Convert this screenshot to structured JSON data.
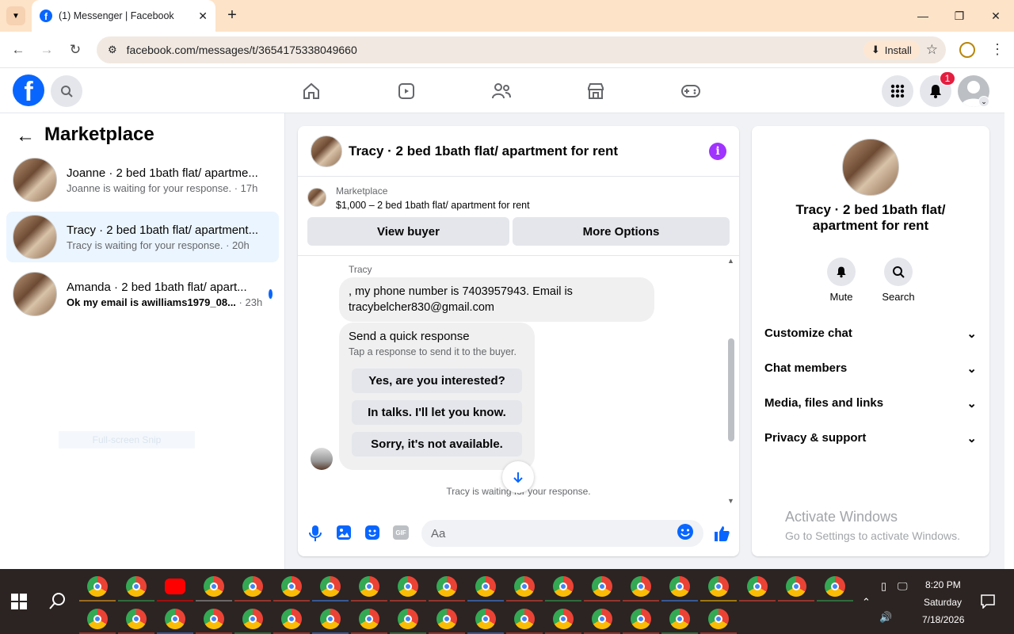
{
  "browser": {
    "tab_title": "(1) Messenger | Facebook",
    "url": "facebook.com/messages/t/3654175338049660",
    "install_label": "Install"
  },
  "fb": {
    "notification_count": "1"
  },
  "sidebar": {
    "title": "Marketplace",
    "conversations": [
      {
        "name": "Joanne · 2 bed 1bath flat/ apartme...",
        "preview": "Joanne is waiting for your response. · 17h"
      },
      {
        "name": "Tracy · 2 bed 1bath flat/ apartment...",
        "preview": "Tracy is waiting for your response. · 20h"
      },
      {
        "name": "Amanda · 2 bed 1bath flat/ apart...",
        "preview": "Ok my email is awilliams1979_08...",
        "time": "· 23h"
      }
    ],
    "snip_text": "Full-screen Snip"
  },
  "chat": {
    "title": "Tracy · 2 bed 1bath flat/ apartment for rent",
    "marketplace_label": "Marketplace",
    "listing": "$1,000 – 2 bed 1bath flat/ apartment for rent",
    "view_buyer": "View buyer",
    "more_options": "More Options",
    "sender": "Tracy",
    "message_line1": ", my phone number is 7403957943. Email is",
    "message_line2": "tracybelcher830@gmail.com",
    "quick_title": "Send a quick response",
    "quick_sub": "Tap a response to send it to the buyer.",
    "quick_replies": [
      "Yes, are you interested?",
      "In talks. I'll let you know.",
      "Sorry, it's not available."
    ],
    "waiting": "Tracy is waiting for your response.",
    "composer_placeholder": "Aa"
  },
  "info_panel": {
    "name_line1": "Tracy · 2 bed 1bath flat/",
    "name_line2": "apartment for rent",
    "mute": "Mute",
    "search": "Search",
    "sections": [
      "Customize chat",
      "Chat members",
      "Media, files and links",
      "Privacy & support"
    ]
  },
  "watermark": {
    "line1": "Activate Windows",
    "line2": "Go to Settings to activate Windows."
  },
  "taskbar": {
    "time": "8:20 PM",
    "day": "Saturday",
    "date": "7/18/2026"
  }
}
